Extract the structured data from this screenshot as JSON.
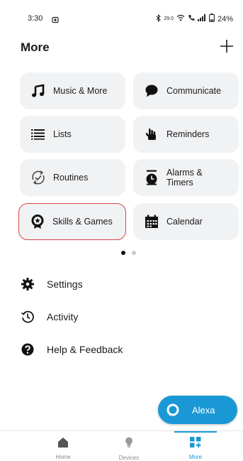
{
  "status": {
    "time": "3:30",
    "battery": "24%",
    "net": "29.0"
  },
  "header": {
    "title": "More"
  },
  "grid": [
    {
      "label": "Music & More",
      "icon": "music-note-icon"
    },
    {
      "label": "Communicate",
      "icon": "speech-bubble-icon"
    },
    {
      "label": "Lists",
      "icon": "list-icon"
    },
    {
      "label": "Reminders",
      "icon": "hand-raised-icon"
    },
    {
      "label": "Routines",
      "icon": "routine-check-icon"
    },
    {
      "label": "Alarms & Timers",
      "icon": "alarm-clock-icon"
    },
    {
      "label": "Skills & Games",
      "icon": "star-badge-icon"
    },
    {
      "label": "Calendar",
      "icon": "calendar-icon"
    }
  ],
  "list": [
    {
      "label": "Settings",
      "icon": "gear-icon"
    },
    {
      "label": "Activity",
      "icon": "history-icon"
    },
    {
      "label": "Help & Feedback",
      "icon": "help-icon"
    }
  ],
  "alexa": {
    "label": "Alexa"
  },
  "nav": [
    {
      "label": "Home"
    },
    {
      "label": "Devices"
    },
    {
      "label": "More"
    }
  ],
  "colors": {
    "accent": "#1a98d5",
    "card": "#f1f2f4",
    "selection": "#d64545"
  }
}
